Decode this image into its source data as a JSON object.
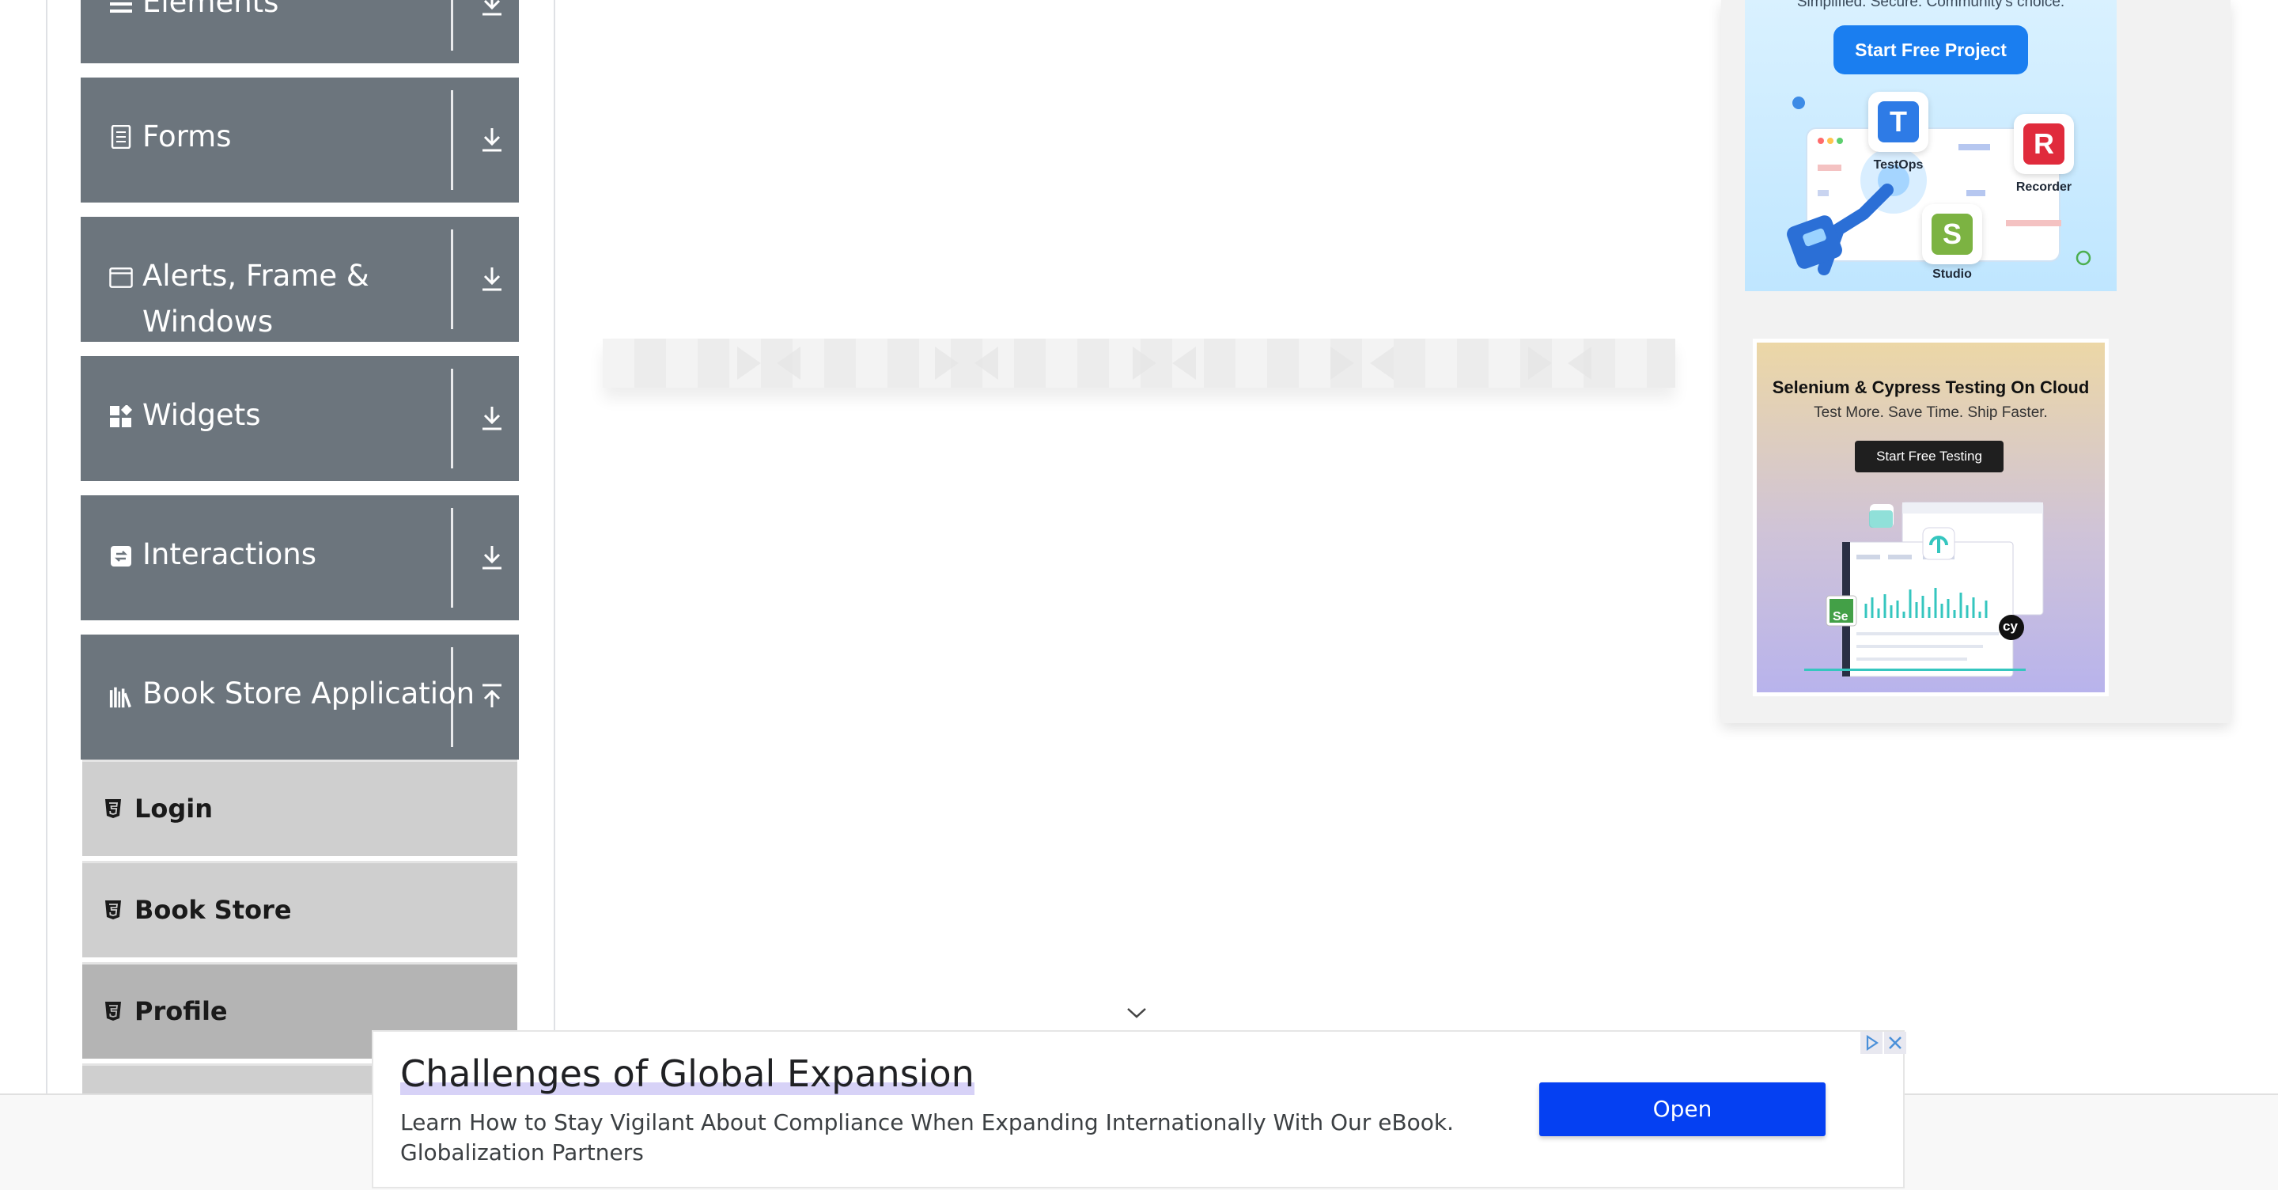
{
  "sidebar": {
    "groups": [
      {
        "label": "Elements",
        "icon": "list-icon",
        "expanded": false
      },
      {
        "label": "Forms",
        "icon": "form-icon",
        "expanded": false
      },
      {
        "label": "Alerts, Frame & Windows",
        "label_line1": "Alerts, Frame &",
        "label_line2": "Windows",
        "icon": "window-icon",
        "expanded": false
      },
      {
        "label": "Widgets",
        "icon": "widgets-icon",
        "expanded": false
      },
      {
        "label": "Interactions",
        "icon": "interactions-icon",
        "expanded": false
      },
      {
        "label": "Book Store Application",
        "icon": "books-icon",
        "expanded": true
      }
    ],
    "book_store_items": [
      {
        "label": "Login",
        "icon": "html5-icon",
        "active": false
      },
      {
        "label": "Book Store",
        "icon": "html5-icon",
        "active": false
      },
      {
        "label": "Profile",
        "icon": "html5-icon",
        "active": true
      }
    ]
  },
  "right_ads": {
    "katalon": {
      "tagline": "Simplified. Secure. Community's choice.",
      "button": "Start Free Project",
      "apps": [
        {
          "name": "TestOps",
          "letter": "T",
          "color": "#2e7be6"
        },
        {
          "name": "Recorder",
          "letter": "R",
          "color": "#e02b3c"
        },
        {
          "name": "Studio",
          "letter": "S",
          "color": "#7cb342"
        }
      ]
    },
    "lambdatest": {
      "title": "Selenium & Cypress Testing On Cloud",
      "subtitle": "Test More. Save Time. Ship Faster.",
      "button": "Start Free Testing",
      "badge_se": "Se",
      "badge_cy": "cy"
    }
  },
  "bottom_ad": {
    "title": "Challenges of Global Expansion",
    "description": "Learn How to Stay Vigilant About Compliance When Expanding Internationally With Our eBook.",
    "advertiser": "Globalization Partners",
    "cta": "Open",
    "cta_color": "#0540f2"
  },
  "colors": {
    "sidebar_header": "#6c757d",
    "menu_item": "#cfcfcf",
    "menu_item_active": "#b4b4b4",
    "katalon_button": "#1a7ef0"
  }
}
